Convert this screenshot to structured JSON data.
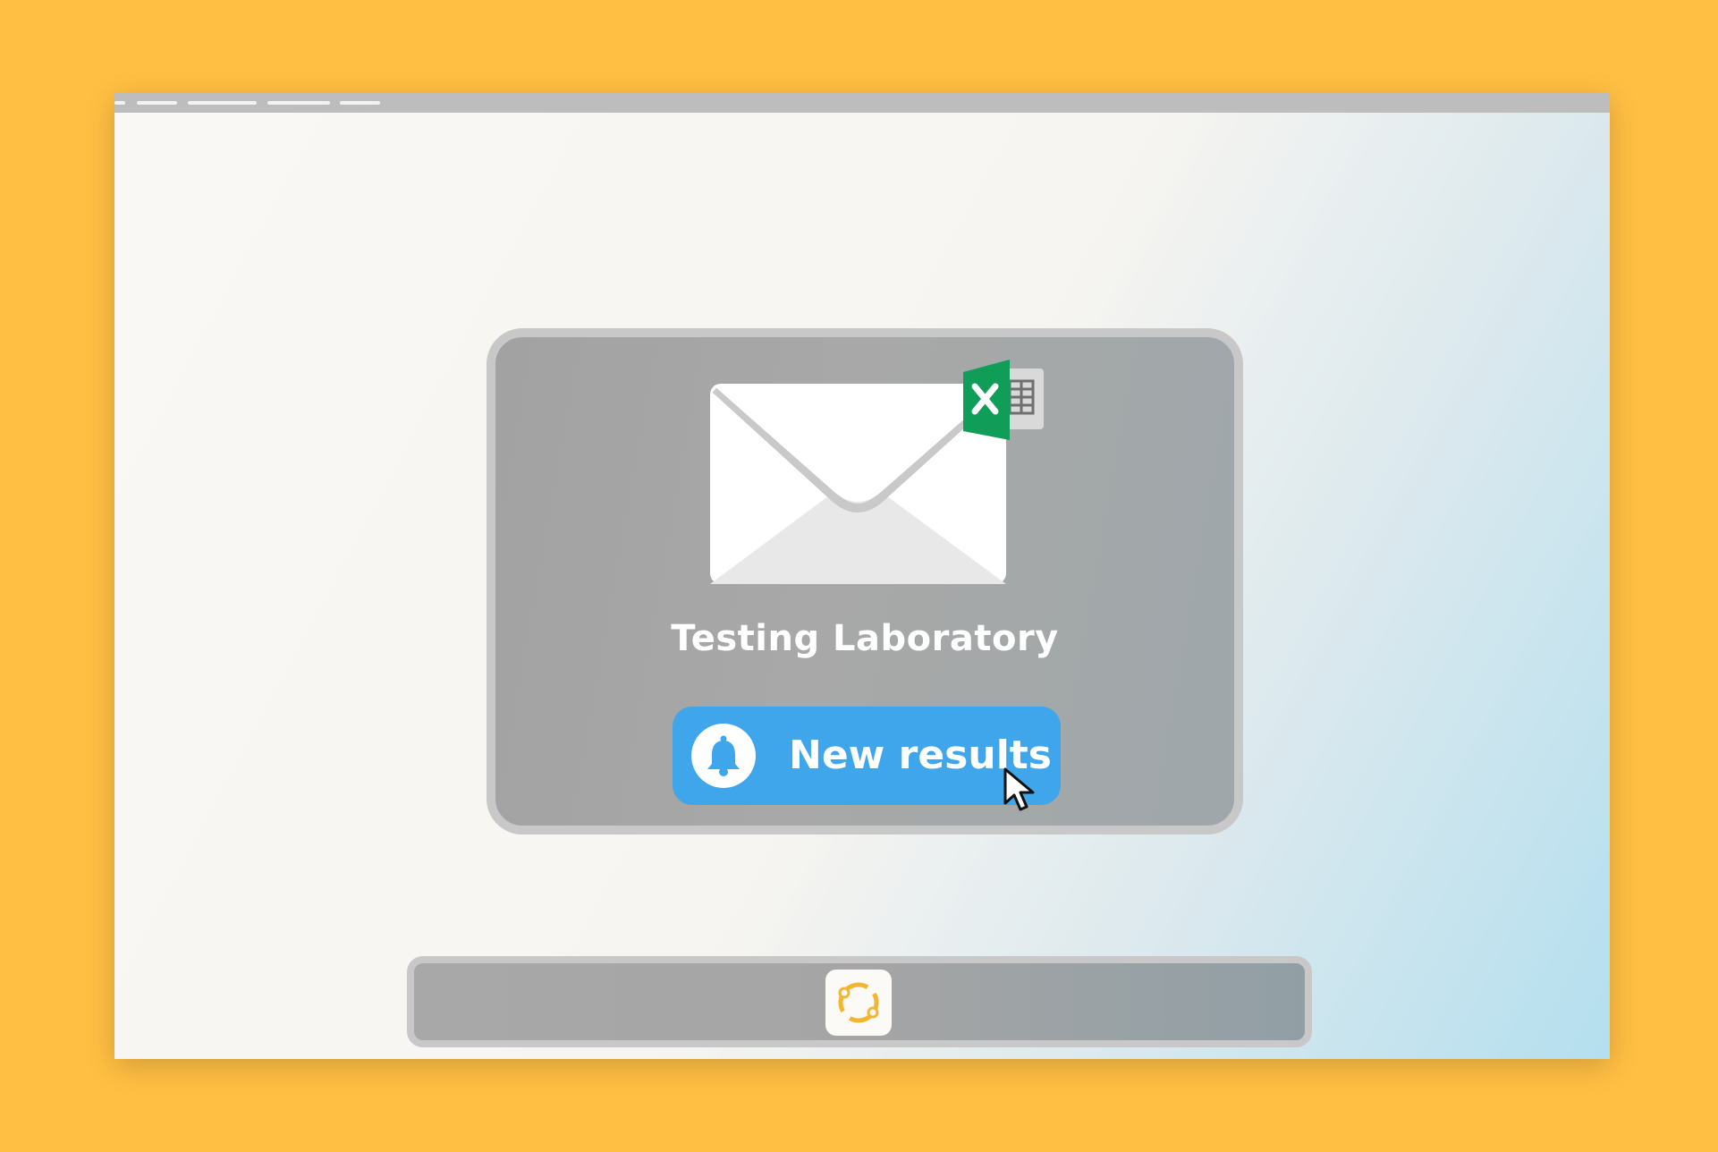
{
  "colors": {
    "background": "#FFBF43",
    "card": "#A6A6A6",
    "card_border": "#C8C8C8",
    "button": "#3FA6EB",
    "excel_green": "#0F9D58",
    "app_icon_accent": "#F4B531"
  },
  "window": {
    "titlebar_icon": "titlebar-dashes"
  },
  "notification_card": {
    "icon": "envelope-icon",
    "attachment_icon": "excel-icon",
    "title": "Testing Laboratory",
    "button": {
      "icon": "bell-icon",
      "label": "New results"
    }
  },
  "dock": {
    "apps": [
      {
        "icon": "sync-app-icon"
      }
    ]
  }
}
